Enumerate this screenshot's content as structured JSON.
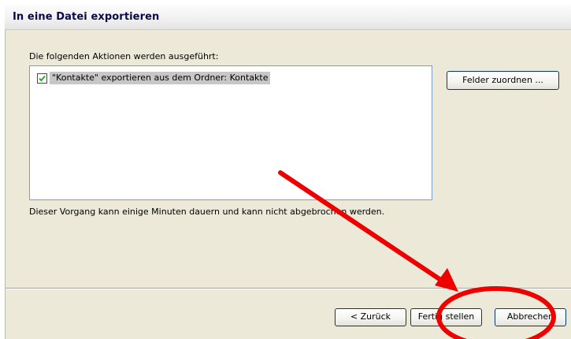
{
  "window": {
    "title": "In eine Datei exportieren"
  },
  "actions": {
    "label": "Die folgenden Aktionen werden ausgeführt:",
    "items": [
      {
        "label": "\"Kontakte\" exportieren aus dem Ordner: Kontakte",
        "checked": true
      }
    ]
  },
  "buttons": {
    "map_fields": "Felder zuordnen ...",
    "back": "< Zurück",
    "finish": "Fertig stellen",
    "cancel": "Abbrechen"
  },
  "info": {
    "text": "Dieser Vorgang kann einige Minuten dauern und kann nicht abgebrochen werden."
  },
  "annotation": {
    "color": "#ee0000",
    "arrow": "arrow-icon",
    "highlight": "circle-highlight"
  },
  "colors": {
    "dialog_bg": "#ece9d8",
    "button_border": "#003c74",
    "list_border": "#7f9db9",
    "selection": "#c7c7c7"
  }
}
